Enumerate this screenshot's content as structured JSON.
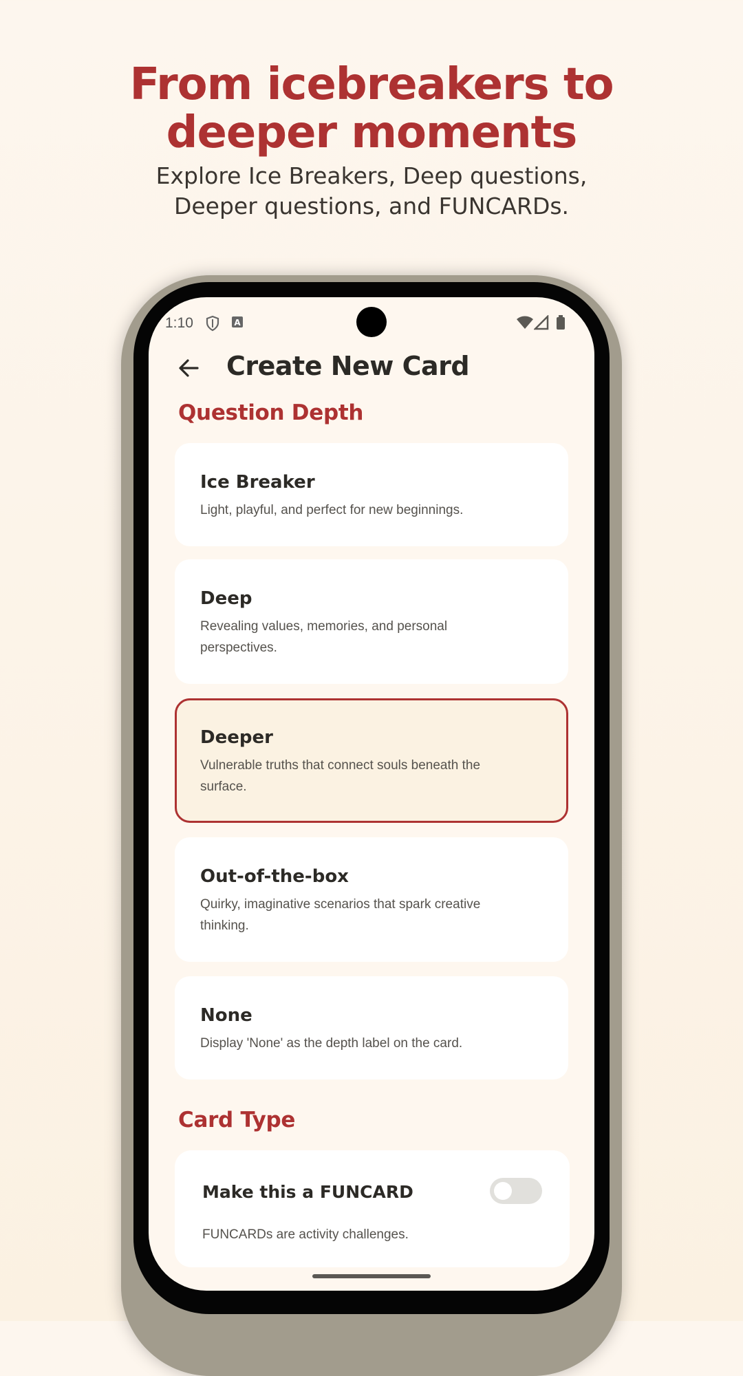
{
  "promo": {
    "title_line1": "From icebreakers to",
    "title_line2": "deeper moments",
    "subtitle_line1": "Explore Ice Breakers, Deep questions,",
    "subtitle_line2": "Deeper questions, and FUNCARDs."
  },
  "status_bar": {
    "time": "1:10",
    "icons": [
      "shield-icon",
      "keyboard-a-icon",
      "wifi-icon",
      "signal-icon",
      "battery-icon"
    ]
  },
  "header": {
    "back_icon": "arrow-left-icon",
    "title": "Create New Card"
  },
  "question_depth": {
    "heading": "Question Depth",
    "selected": "Deeper",
    "options": [
      {
        "title": "Ice Breaker",
        "description": "Light, playful, and perfect for new beginnings."
      },
      {
        "title": "Deep",
        "description_line1": "Revealing values, memories, and personal",
        "description_line2": "perspectives."
      },
      {
        "title": "Deeper",
        "description_line1": "Vulnerable truths that connect souls beneath the",
        "description_line2": "surface."
      },
      {
        "title": "Out-of-the-box",
        "description_line1": "Quirky, imaginative scenarios that spark creative",
        "description_line2": "thinking."
      },
      {
        "title": "None",
        "description": "Display 'None' as the depth label on the card."
      }
    ]
  },
  "card_type": {
    "heading": "Card Type",
    "toggle_label": "Make this a FUNCARD",
    "toggle_on": false,
    "toggle_description": "FUNCARDs are activity challenges."
  },
  "colors": {
    "accent": "#ad3232",
    "background": "#fdf6ee",
    "selected_card": "#fbf2e2"
  }
}
